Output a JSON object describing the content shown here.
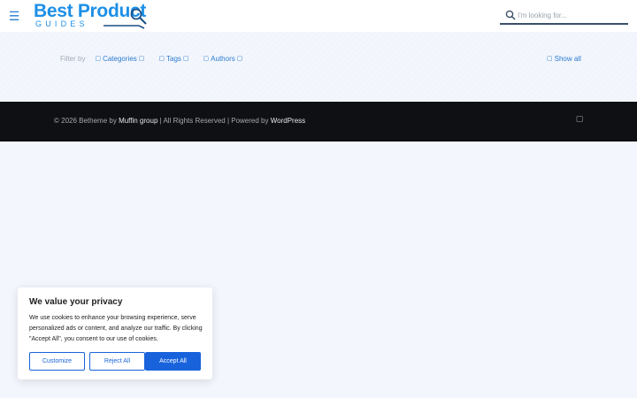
{
  "header": {
    "logo": {
      "brand": "Best Product",
      "sub": "GUIDES"
    },
    "search": {
      "placeholder": "I'm looking for..."
    }
  },
  "filter": {
    "label": "Filter by",
    "links": [
      {
        "label": "Categories",
        "icon": "docs-icon"
      },
      {
        "label": "Tags",
        "icon": "tag-icon"
      },
      {
        "label": "Authors",
        "icon": "user-icon"
      }
    ],
    "show_all": "Show all"
  },
  "footer": {
    "copyright_prefix": "© 2026 Betheme by ",
    "muffin": "Muffin group",
    "copyright_mid": " | All Rights Reserved | Powered by ",
    "wordpress": "WordPress"
  },
  "cookie": {
    "title": "We value your privacy",
    "text": "We use cookies to enhance your browsing experience, serve personalized ads or content, and analyze our traffic. By clicking \"Accept All\", you consent to our use of cookies.",
    "customize": "Customize",
    "reject": "Reject All",
    "accept": "Accept All"
  },
  "colors": {
    "accent": "#1863dc",
    "link": "#2a7bd0",
    "brand": "#1d8fe6",
    "footer_bg": "#0e1014",
    "page_bg": "#f3f6fd"
  }
}
